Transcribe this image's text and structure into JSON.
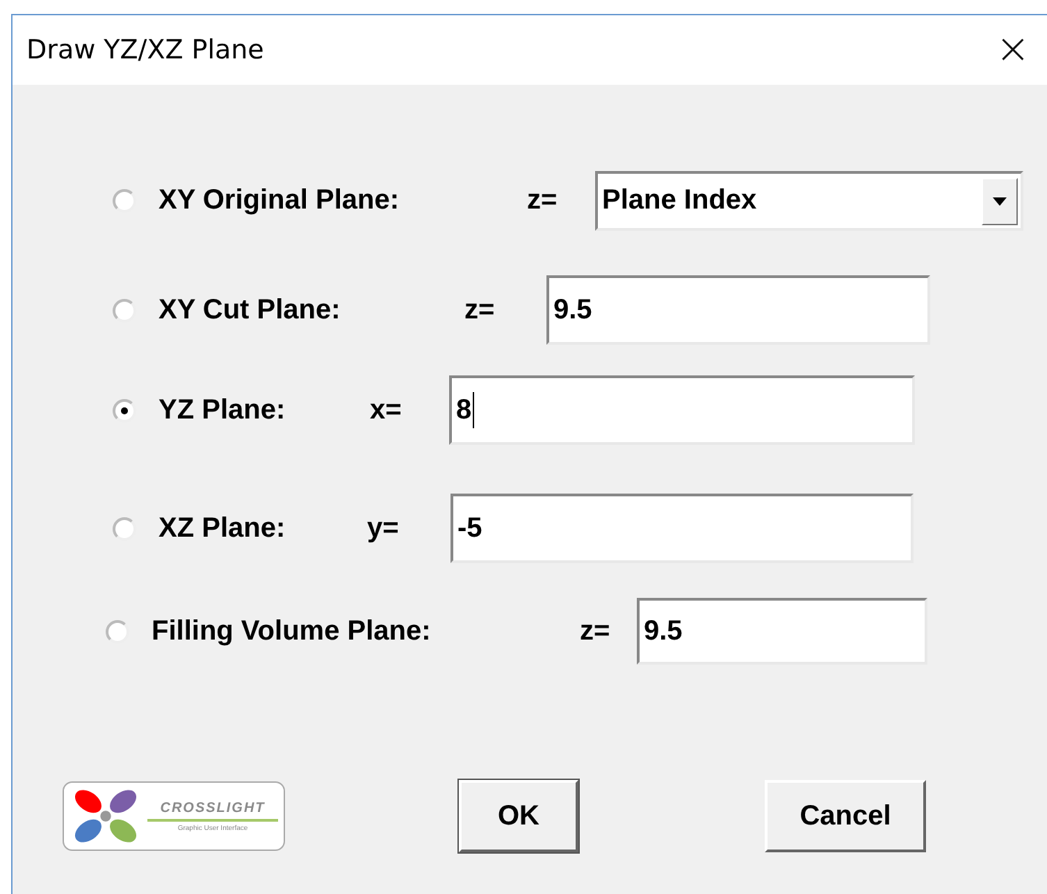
{
  "window": {
    "title": "Draw YZ/XZ Plane",
    "close": "×"
  },
  "options": [
    {
      "label": "XY Original Plane:",
      "var_label": "z=",
      "kind": "dropdown",
      "value": "Plane Index",
      "selected": false
    },
    {
      "label": "XY Cut Plane:",
      "var_label": "z=",
      "kind": "field",
      "value": "9.5",
      "selected": false
    },
    {
      "label": "YZ Plane:",
      "var_label": "x=",
      "kind": "field",
      "value": "8",
      "selected": true
    },
    {
      "label": "XZ Plane:",
      "var_label": "y=",
      "kind": "field",
      "value": "-5",
      "selected": false
    },
    {
      "label": "Filling Volume Plane:",
      "var_label": "z=",
      "kind": "field",
      "value": "9.5",
      "selected": false
    }
  ],
  "logo": {
    "name": "CROSSLIGHT",
    "tagline": "Graphic User Interface"
  },
  "buttons": [
    "OK",
    "Cancel"
  ]
}
